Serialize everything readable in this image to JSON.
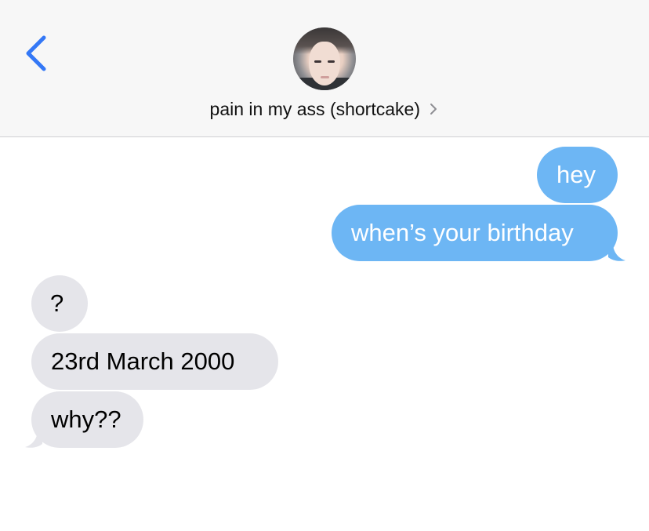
{
  "header": {
    "back_icon": "chevron-left-icon",
    "contact_name": "pain in my ass (shortcake)",
    "detail_icon": "chevron-right-icon",
    "accent_color": "#3478f6"
  },
  "messages": [
    {
      "direction": "sent",
      "text": "hey"
    },
    {
      "direction": "sent",
      "text": "when’s your birthday"
    },
    {
      "direction": "received",
      "text": "?"
    },
    {
      "direction": "received",
      "text": "23rd March 2000"
    },
    {
      "direction": "received",
      "text": "why??"
    }
  ],
  "colors": {
    "sent_bubble": "#6db6f4",
    "received_bubble": "#e5e5ea",
    "header_background": "#f7f7f7"
  }
}
